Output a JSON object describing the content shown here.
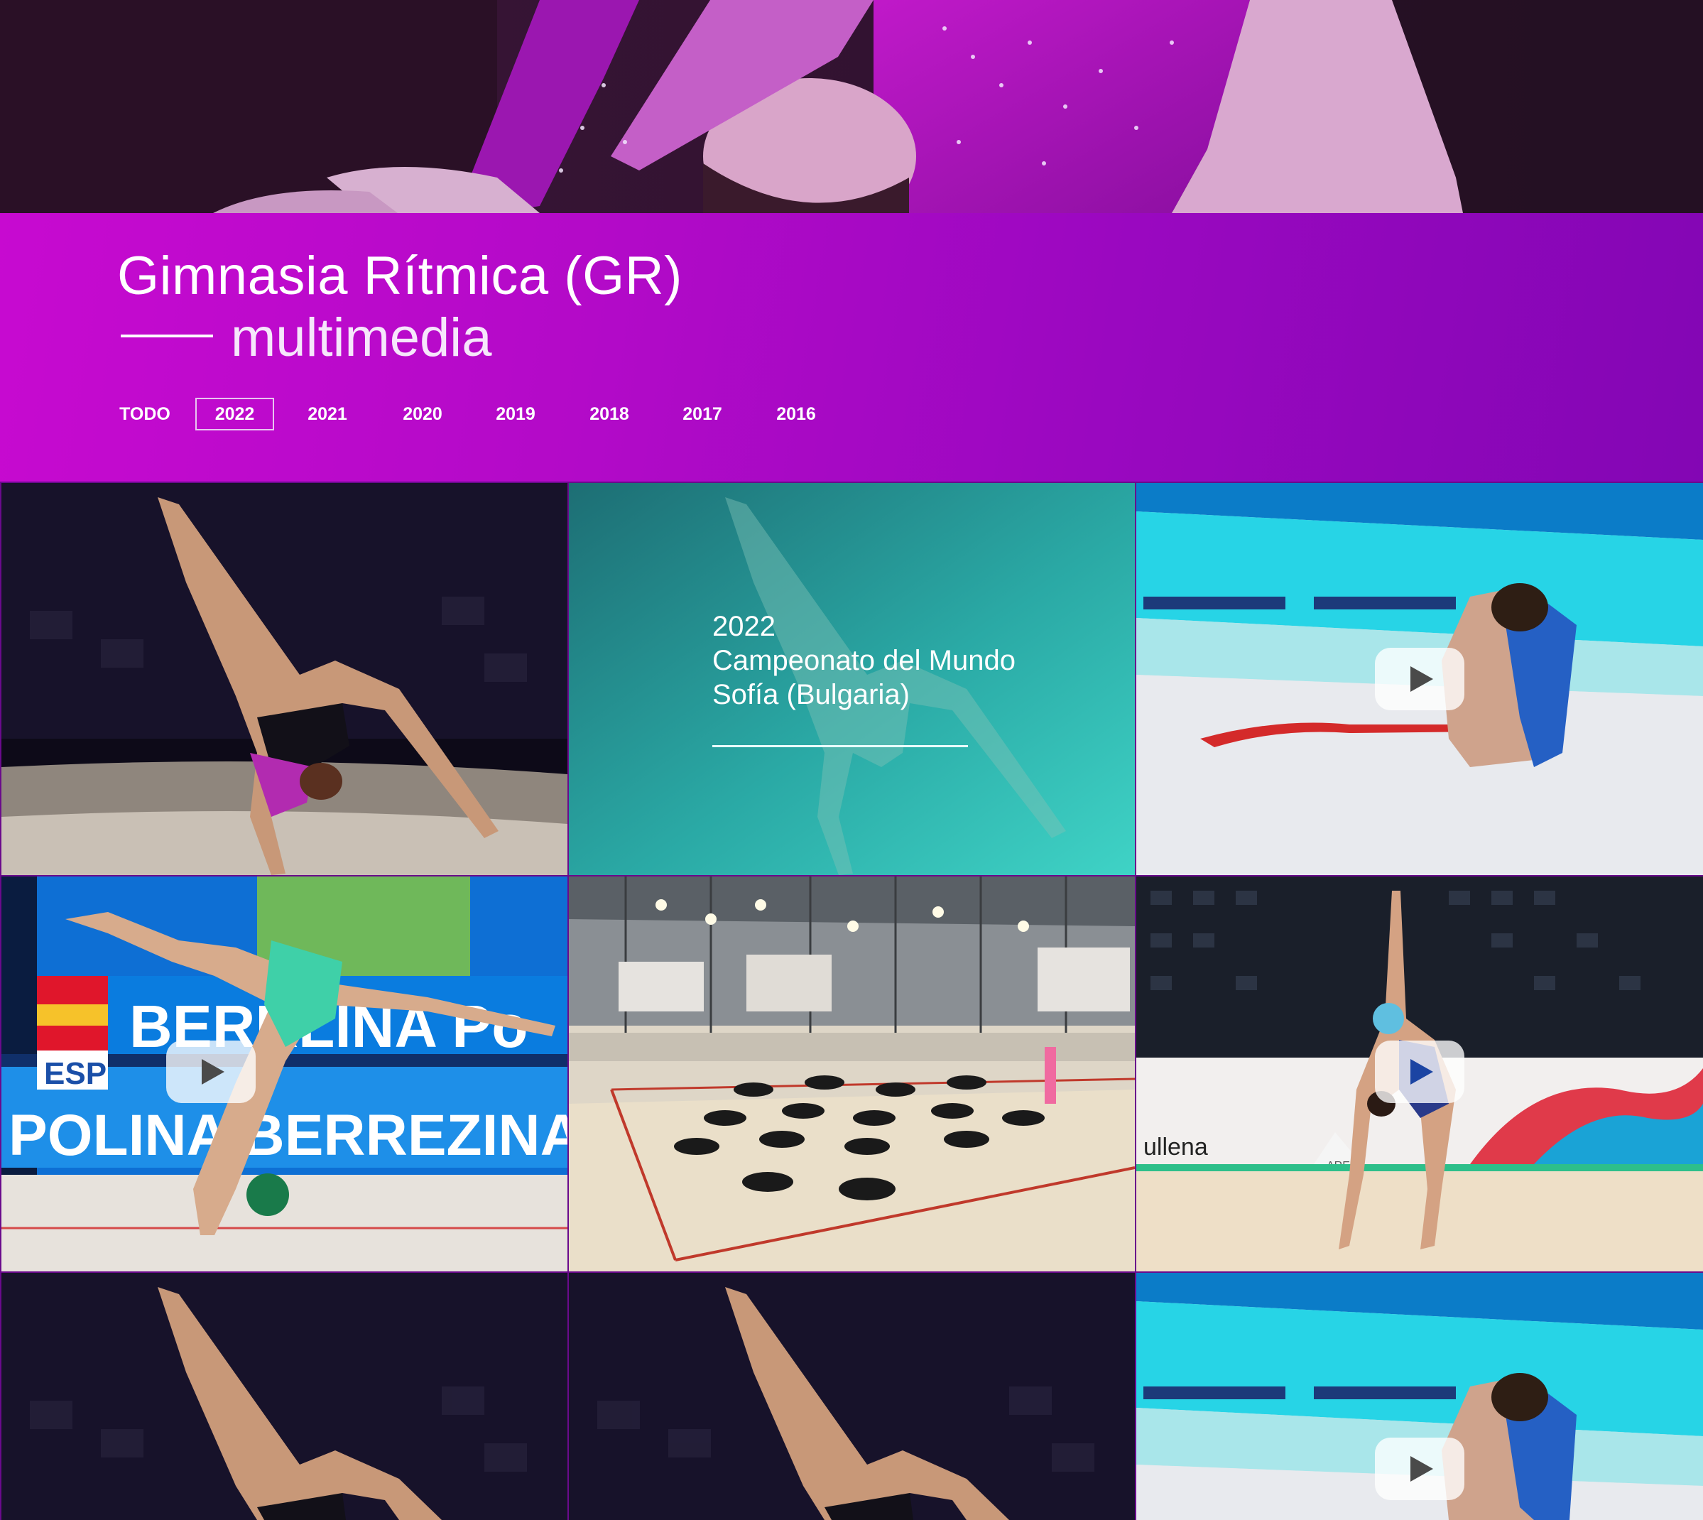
{
  "page": {
    "title": "Gimnasia Rítmica (GR)",
    "subtitle": "multimedia"
  },
  "filters": {
    "active": "2022",
    "tabs": [
      "TODO",
      "2022",
      "2021",
      "2020",
      "2019",
      "2018",
      "2017",
      "2016"
    ]
  },
  "featured": {
    "year": "2022",
    "event": "Campeonato del Mundo",
    "location": "Sofía (Bulgaria)"
  },
  "gallery": [
    {
      "type": "photo",
      "subject": "gymnast-backbend-dark-arena"
    },
    {
      "type": "featured-card"
    },
    {
      "type": "video",
      "subject": "gymnast-seated-ribbon",
      "play_icon": "play-icon"
    },
    {
      "type": "video",
      "subject": "gymnast-ball-handstand",
      "scoreboard_country": "ESP",
      "scoreboard_name": "BERRLINA Po",
      "board_name": "POLINA BERREZINA",
      "play_icon": "play-icon"
    },
    {
      "type": "photo",
      "subject": "training-hall-group"
    },
    {
      "type": "video",
      "subject": "gymnast-leg-extension-arena",
      "sponsor_text": "ARENA",
      "sponsor_partial": "ullena",
      "play_icon": "play-icon"
    },
    {
      "type": "photo",
      "subject": "gymnast-backbend-dark-arena"
    },
    {
      "type": "photo",
      "subject": "gymnast-backbend-dark-arena"
    },
    {
      "type": "video",
      "subject": "gymnast-seated-ribbon",
      "play_icon": "play-icon"
    }
  ],
  "colors": {
    "band_start": "#c70ad0",
    "band_end": "#8306b4",
    "featured_teal": "#2fb8b0",
    "grid_divider": "#6a0a8c"
  }
}
